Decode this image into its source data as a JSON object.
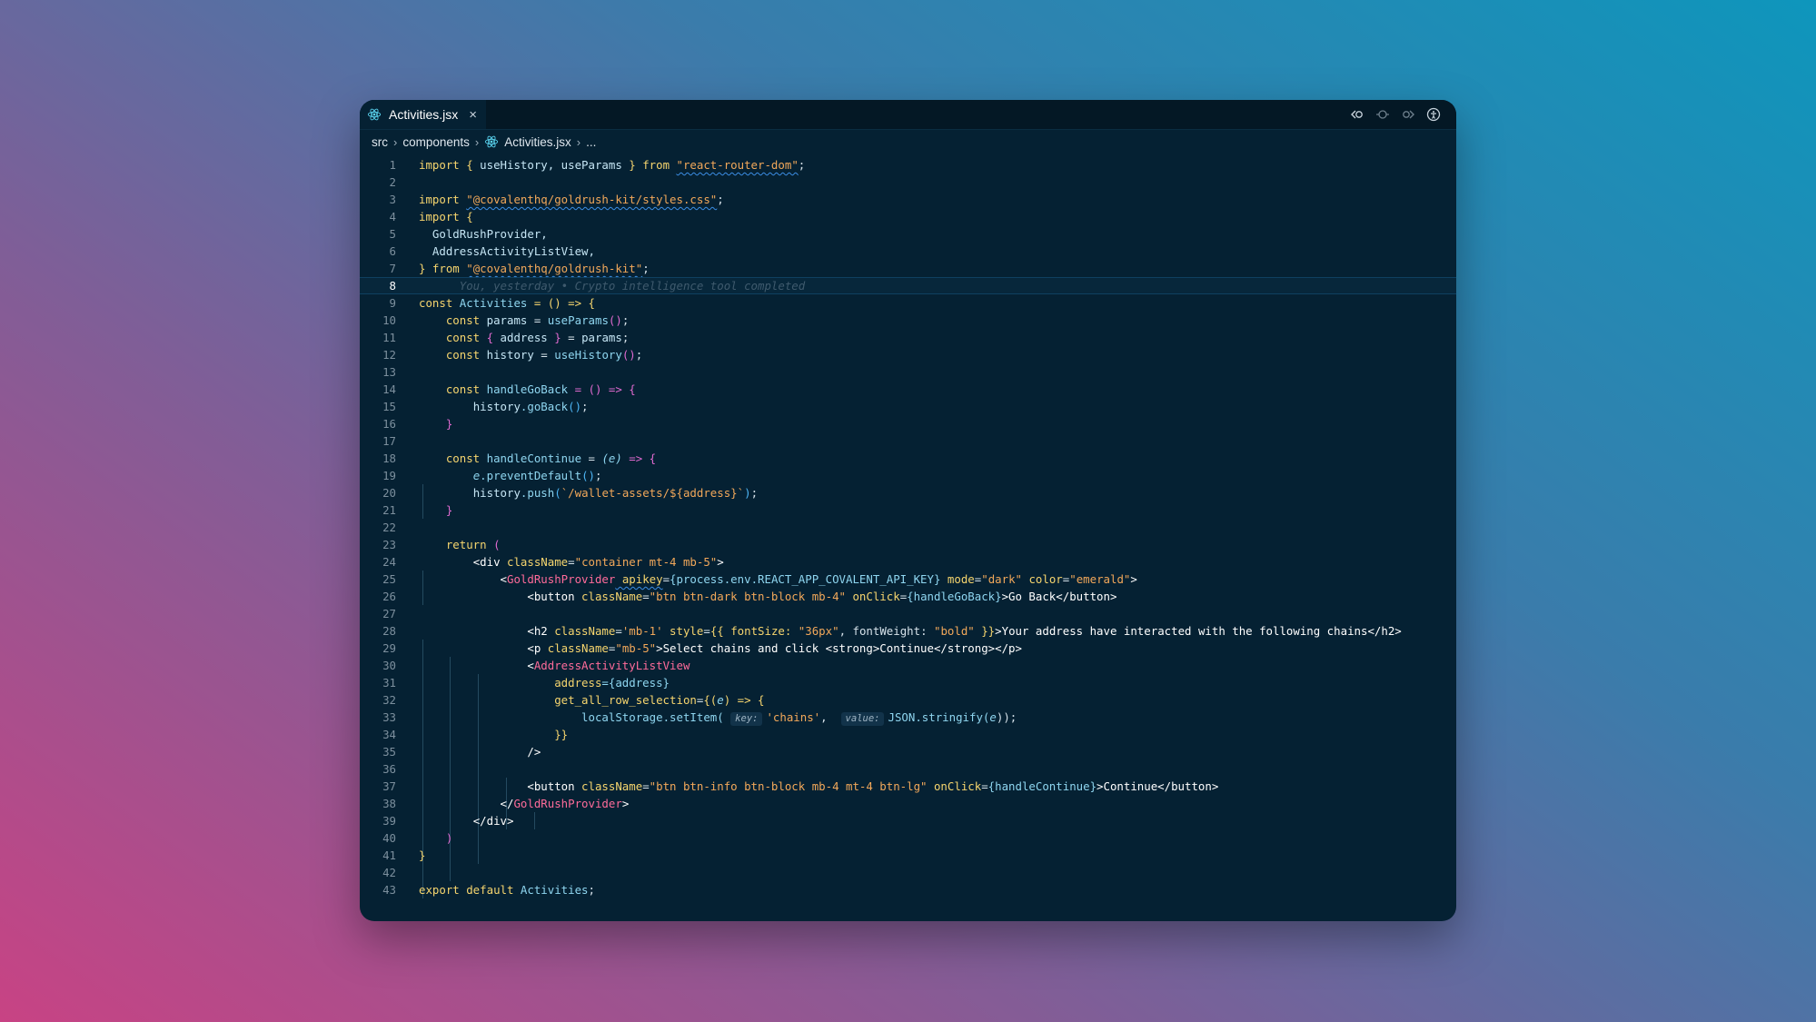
{
  "tab": {
    "filename": "Activities.jsx",
    "close_icon": "×"
  },
  "breadcrumb": {
    "parts": [
      "src",
      "components"
    ],
    "file": "Activities.jsx",
    "ellipsis": "..."
  },
  "editor": {
    "active_line": 8,
    "blame": "You, yesterday • Crypto intelligence tool completed",
    "line_numbers": [
      "1",
      "2",
      "3",
      "4",
      "5",
      "6",
      "7",
      "8",
      "9",
      "10",
      "11",
      "12",
      "13",
      "14",
      "15",
      "16",
      "17",
      "18",
      "19",
      "20",
      "21",
      "22",
      "23",
      "24",
      "25",
      "26",
      "27",
      "28",
      "29",
      "30",
      "31",
      "32",
      "33",
      "34",
      "35",
      "36",
      "37",
      "38",
      "39",
      "40",
      "41",
      "42",
      "43"
    ],
    "lines": {
      "l1": {
        "kw_import": "import",
        "open": "{ ",
        "names": "useHistory, useParams",
        "close": " }",
        "from": " from ",
        "mod": "\"react-router-dom\"",
        "semi": ";"
      },
      "l3": {
        "kw": "import",
        "mod": "\"@covalenthq/goldrush-kit/styles.css\"",
        "semi": ";"
      },
      "l4": {
        "kw": "import",
        "open": " {"
      },
      "l5": {
        "name": "GoldRushProvider,",
        "indent": "  "
      },
      "l6": {
        "name": "AddressActivityListView,",
        "indent": "  "
      },
      "l7": {
        "close": "}",
        "from": " from ",
        "mod": "\"@covalenthq/goldrush-kit\"",
        "semi": ";"
      },
      "l9": {
        "kw": "const",
        "name": "Activities",
        "rest": " = () => {"
      },
      "l10": {
        "kw": "const",
        "name": " params",
        "eq": " = ",
        "fn": "useParams",
        "call": "()",
        "semi": ";"
      },
      "l11": {
        "kw": "const",
        "open": " { ",
        "name": "address",
        "close": " } ",
        "eq": "= ",
        "val": "params",
        "semi": ";"
      },
      "l12": {
        "kw": "const",
        "name": " history",
        "eq": " = ",
        "fn": "useHistory",
        "call": "()",
        "semi": ";"
      },
      "l14": {
        "kw": "const",
        "name": " handleGoBack",
        "rest": " = () => {"
      },
      "l15": {
        "obj": "history",
        "fn": ".goBack",
        "call": "()",
        "semi": ";"
      },
      "l16": {
        "close": "}"
      },
      "l18": {
        "kw": "const",
        "name": " handleContinue",
        "eq": " = ",
        "param": "(e)",
        "rest": " => {"
      },
      "l19": {
        "obj": "e",
        "fn": ".preventDefault",
        "call": "()",
        "semi": ";"
      },
      "l20": {
        "obj": "history",
        "fn": ".push",
        "open": "(",
        "tpl": "`/wallet-assets/${address}`",
        "close": ")",
        "semi": ";"
      },
      "l21": {
        "close": "}"
      },
      "l23": {
        "kw": "return",
        "open": " ("
      },
      "l24": {
        "open": "<div ",
        "attr": "className",
        "eq": "=",
        "val": "\"container mt-4 mb-5\"",
        "close": ">"
      },
      "l25": {
        "open": "<",
        "comp": "GoldRushProvider",
        "attr1": " apikey",
        "eq1": "=",
        "val1": "{process.env.REACT_APP_COVALENT_API_KEY}",
        "attr2": " mode",
        "val2": "\"dark\"",
        "attr3": " color",
        "val3": "\"emerald\"",
        "close": ">"
      },
      "l26": {
        "open": "<button ",
        "attr1": "className",
        "val1": "\"btn btn-dark btn-block mb-4\"",
        "attr2": " onClick",
        "val2": "{handleGoBack}",
        "text": ">Go Back</button>"
      },
      "l28": {
        "open": "<h2 ",
        "attr1": "className",
        "val1": "'mb-1'",
        "attr2": " style",
        "val2a": "{{ fontSize: ",
        "val2b": "\"36px\"",
        "val2c": ", fontWeight: ",
        "val2d": "\"bold\"",
        "val2e": " }}",
        "text": ">Your address have interacted with the following chains</h2>"
      },
      "l29": {
        "open": "<p ",
        "attr": "className",
        "val": "\"mb-5\"",
        "text": ">Select chains and click <strong>Continue</strong></p>"
      },
      "l30": {
        "open": "<",
        "comp": "AddressActivityListView"
      },
      "l31": {
        "attr": "address",
        "val": "={address}"
      },
      "l32": {
        "attr": "get_all_row_selection",
        "eq": "=",
        "rest": "{(",
        "param": "e",
        "rest2": ") => {"
      },
      "l33": {
        "fn": "localStorage.setItem(",
        "hint1": "key:",
        "arg1": "'chains'",
        "comma": ", ",
        "hint2": "value:",
        "arg2": "JSON.stringify(",
        "arg3": "e",
        "close": "));"
      },
      "l34": {
        "close": "}}"
      },
      "l35": {
        "close": "/>"
      },
      "l37": {
        "open": "<button ",
        "attr1": "className",
        "val1": "\"btn btn-info btn-block mb-4 mt-4 btn-lg\"",
        "attr2": " onClick",
        "val2": "{handleContinue}",
        "text": ">Continue</button>"
      },
      "l38": {
        "open": "</",
        "comp": "GoldRushProvider",
        "close": ">"
      },
      "l39": {
        "text": "</div>"
      },
      "l40": {
        "text": ")"
      },
      "l41": {
        "text": "}"
      },
      "l43": {
        "kw1": "export",
        "kw2": " default ",
        "name": "Activities",
        "semi": ";"
      }
    }
  },
  "toolbar": {
    "icons": [
      "go-back-icon",
      "changes-icon",
      "go-forward-icon",
      "accessibility-icon"
    ]
  }
}
